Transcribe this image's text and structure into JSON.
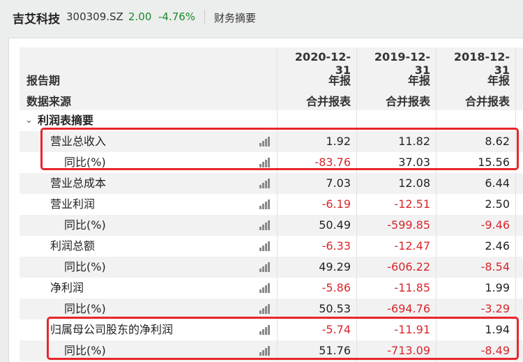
{
  "header": {
    "company": "吉艾科技",
    "code": "300309.SZ",
    "price": "2.00",
    "change": "-4.76%",
    "section": "财务摘要"
  },
  "table": {
    "label_period": "报告期",
    "label_source": "数据来源",
    "columns": [
      {
        "date": "2020-12-31",
        "type": "年报",
        "source": "合并报表"
      },
      {
        "date": "2019-12-31",
        "type": "年报",
        "source": "合并报表"
      },
      {
        "date": "2018-12-31",
        "type": "年报",
        "source": "合并报表"
      }
    ],
    "group": "利润表摘要",
    "rows": [
      {
        "label": "营业总收入",
        "values": [
          "1.92",
          "11.82",
          "8.62"
        ]
      },
      {
        "label": "同比(%)",
        "values": [
          "-83.76",
          "37.03",
          "15.56"
        ]
      },
      {
        "label": "营业总成本",
        "values": [
          "7.03",
          "12.08",
          "6.44"
        ]
      },
      {
        "label": "营业利润",
        "values": [
          "-6.19",
          "-12.51",
          "2.50"
        ]
      },
      {
        "label": "同比(%)",
        "values": [
          "50.49",
          "-599.85",
          "-9.46"
        ]
      },
      {
        "label": "利润总额",
        "values": [
          "-6.33",
          "-12.47",
          "2.46"
        ]
      },
      {
        "label": "同比(%)",
        "values": [
          "49.29",
          "-606.22",
          "-8.54"
        ]
      },
      {
        "label": "净利润",
        "values": [
          "-5.86",
          "-11.85",
          "1.99"
        ]
      },
      {
        "label": "同比(%)",
        "values": [
          "50.53",
          "-694.76",
          "-3.29"
        ]
      },
      {
        "label": "归属母公司股东的净利润",
        "values": [
          "-5.74",
          "-11.91",
          "1.94"
        ]
      },
      {
        "label": "同比(%)",
        "values": [
          "51.76",
          "-713.09",
          "-8.49"
        ]
      }
    ]
  },
  "colors": {
    "positive_price": "#1a8a2a",
    "negative_value": "#d8262b",
    "highlight_box": "#e8262b"
  }
}
